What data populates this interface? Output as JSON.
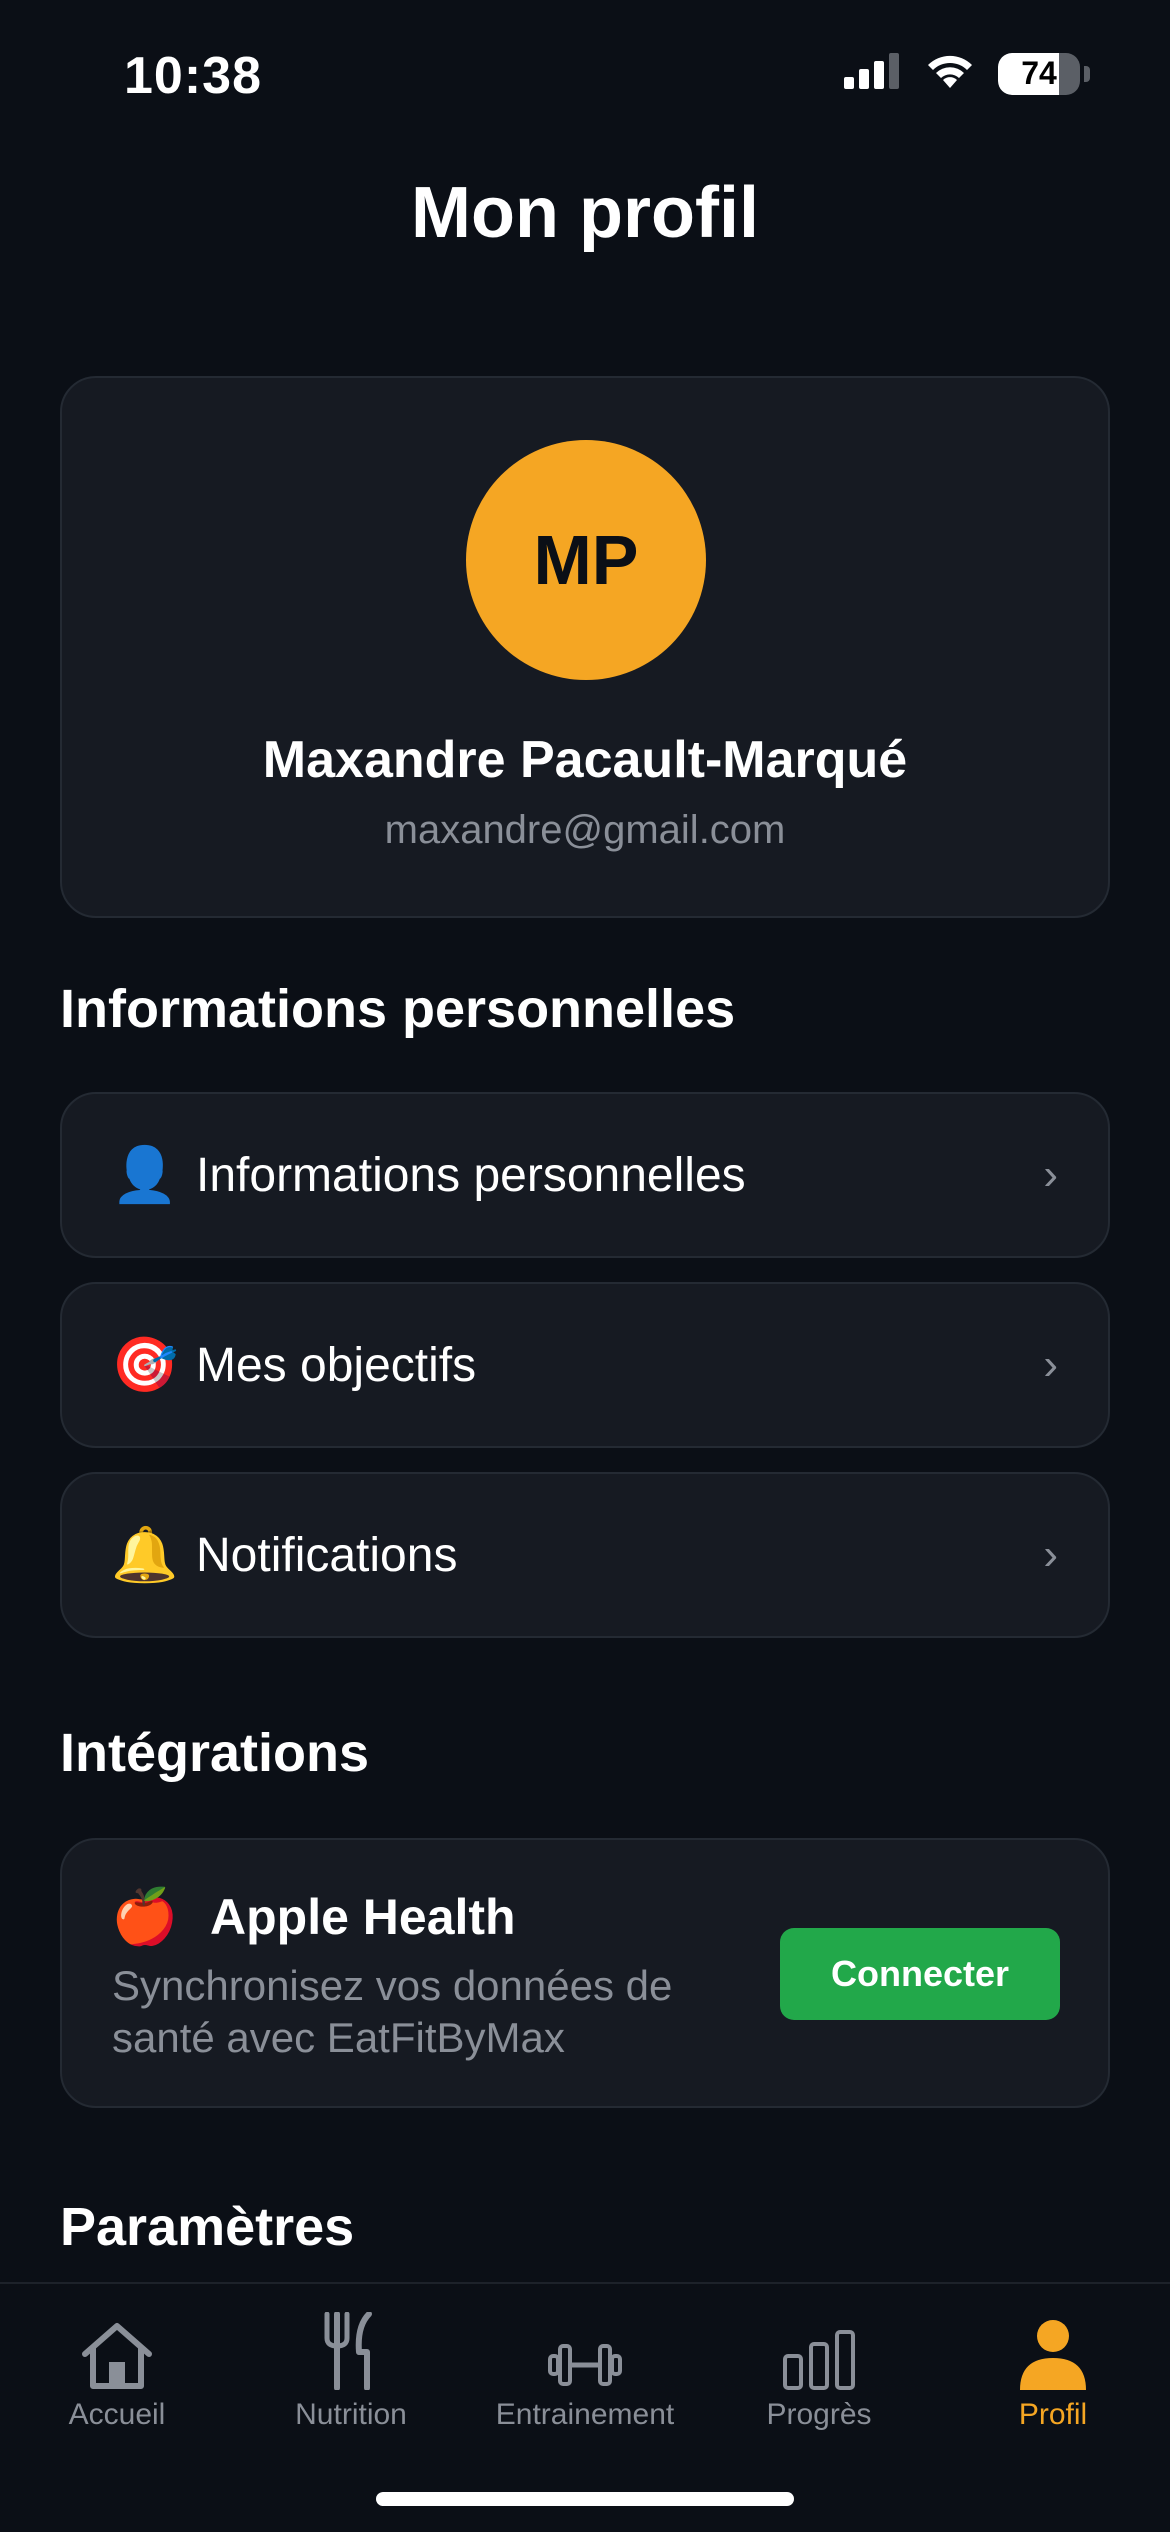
{
  "status_bar": {
    "time": "10:38",
    "battery": "74",
    "battery_level_percent": 74
  },
  "header": {
    "title": "Mon profil"
  },
  "profile": {
    "initials": "MP",
    "name": "Maxandre Pacault-Marqué",
    "email": "maxandre@gmail.com",
    "avatar_color": "#f5a623"
  },
  "sections": {
    "personal_title": "Informations personnelles",
    "integrations_title": "Intégrations",
    "settings_title": "Paramètres"
  },
  "menu": [
    {
      "icon": "person-silhouette-icon",
      "emoji": "👤",
      "label": "Informations personnelles"
    },
    {
      "icon": "target-icon",
      "emoji": "🎯",
      "label": "Mes objectifs"
    },
    {
      "icon": "bell-icon",
      "emoji": "🔔",
      "label": "Notifications"
    }
  ],
  "chevron": "›",
  "integration": {
    "icon": "apple-icon",
    "emoji": "🍎",
    "title": "Apple Health",
    "description": "Synchronisez vos données de santé avec EatFitByMax",
    "button_label": "Connecter",
    "button_color": "#22a84a"
  },
  "tabs": [
    {
      "label": "Accueil",
      "icon": "home-icon"
    },
    {
      "label": "Nutrition",
      "icon": "fork-knife-icon"
    },
    {
      "label": "Entrainement",
      "icon": "dumbbell-icon"
    },
    {
      "label": "Progrès",
      "icon": "bar-chart-icon"
    },
    {
      "label": "Profil",
      "icon": "person-icon",
      "active": true
    }
  ],
  "colors": {
    "background": "#0b0f16",
    "card": "#161a22",
    "accent": "#f5a623",
    "muted_text": "#8a8f98"
  }
}
